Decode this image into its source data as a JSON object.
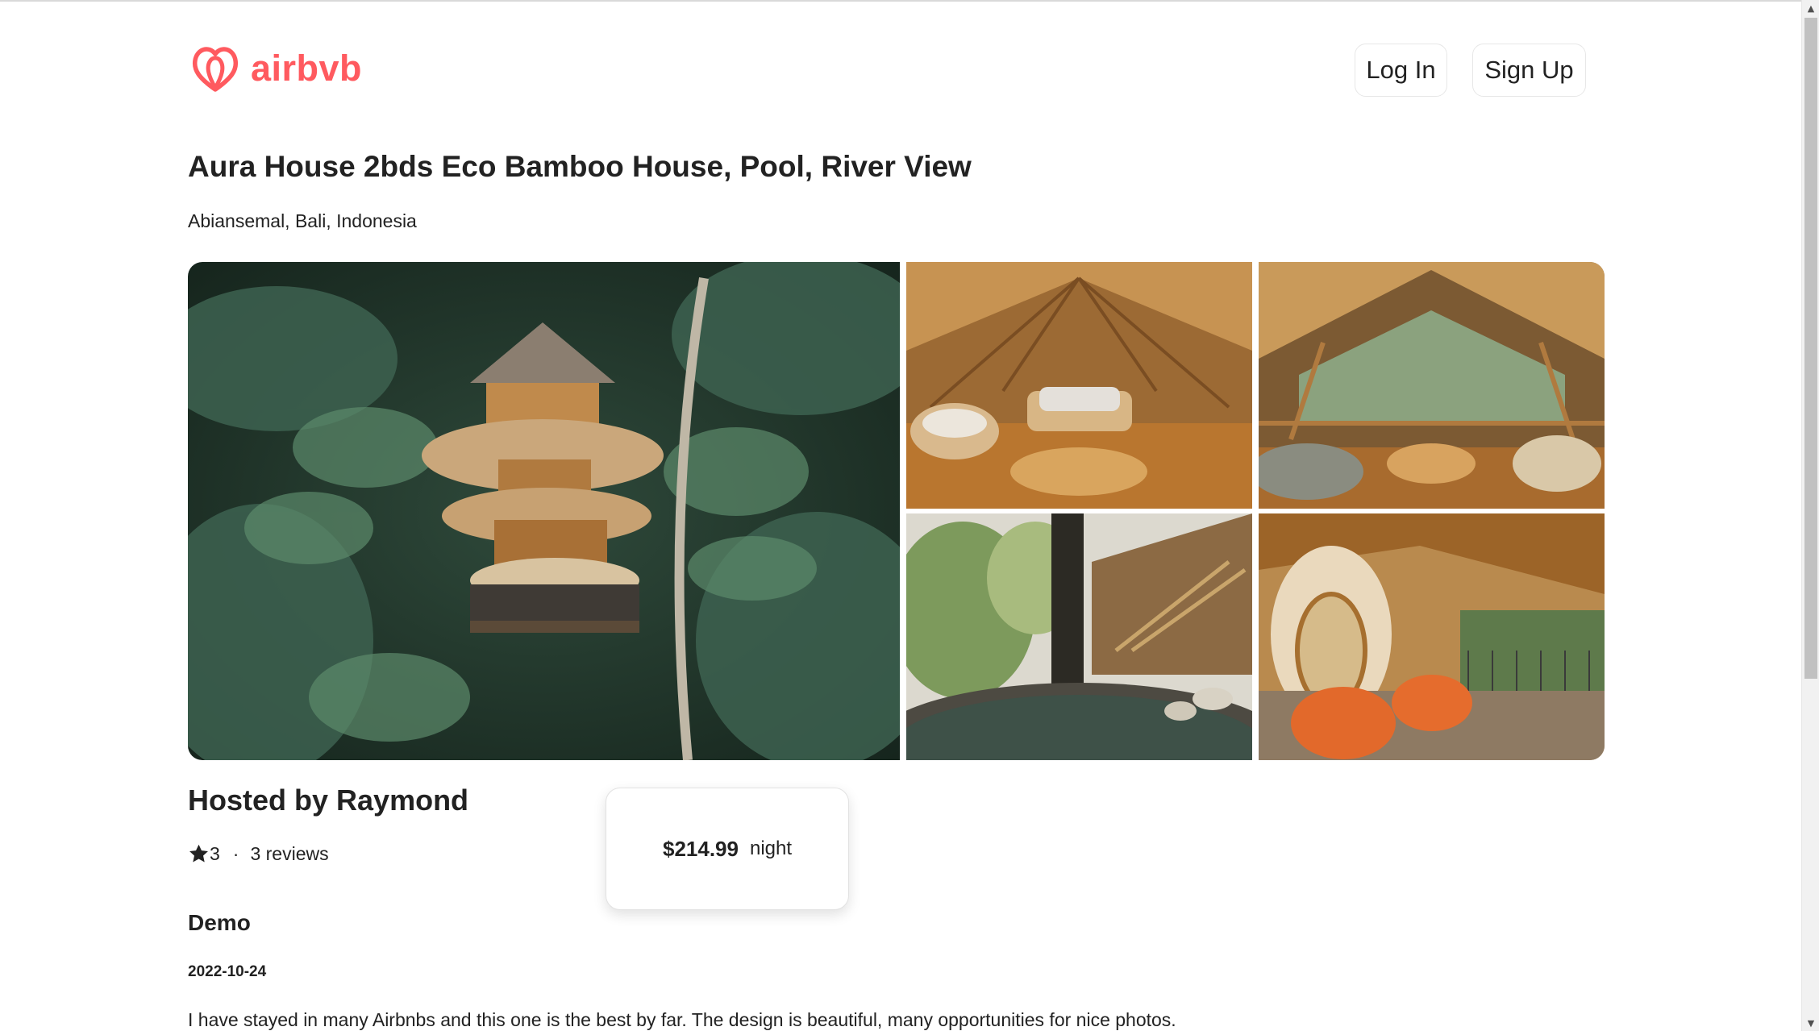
{
  "brand": {
    "name": "airbvb",
    "icon": "airbnb-belo-icon",
    "color": "#ff5a5f"
  },
  "header": {
    "login_label": "Log In",
    "signup_label": "Sign Up"
  },
  "listing": {
    "title": "Aura House 2bds Eco Bamboo House, Pool, River View",
    "location": "Abiansemal, Bali, Indonesia",
    "photos": [
      {
        "icon": "bamboo-treehouse-jungle-photo"
      },
      {
        "icon": "bamboo-living-room-photo"
      },
      {
        "icon": "bamboo-terrace-view-photo"
      },
      {
        "icon": "river-pool-photo"
      },
      {
        "icon": "bamboo-pod-bedroom-photo"
      }
    ]
  },
  "host": {
    "label": "Hosted by Raymond",
    "rating": "3",
    "separator": "·",
    "reviews_label": "3 reviews",
    "star_icon": "star-icon"
  },
  "price": {
    "amount": "$214.99",
    "unit": "night"
  },
  "reviews": [
    {
      "author": "Demo",
      "date": "2022-10-24",
      "text": "I have stayed in many Airbnbs and this one is the best by far. The design is beautiful, many opportunities for nice photos."
    }
  ]
}
